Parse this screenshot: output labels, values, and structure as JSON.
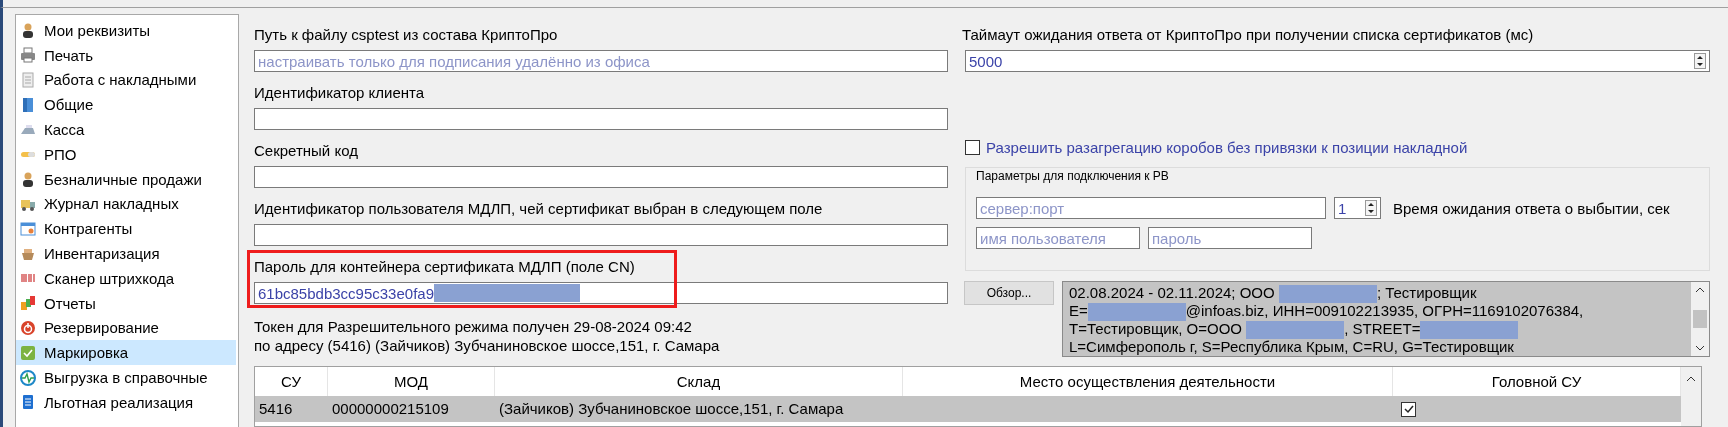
{
  "sidebar": {
    "items": [
      {
        "label": "Мои реквизиты",
        "selected": false
      },
      {
        "label": "Печать",
        "selected": false
      },
      {
        "label": "Работа с накладными",
        "selected": false
      },
      {
        "label": "Общие",
        "selected": false
      },
      {
        "label": "Касса",
        "selected": false
      },
      {
        "label": "РПО",
        "selected": false
      },
      {
        "label": "Безналичные продажи",
        "selected": false
      },
      {
        "label": "Журнал накладных",
        "selected": false
      },
      {
        "label": "Контрагенты",
        "selected": false
      },
      {
        "label": "Инвентаризация",
        "selected": false
      },
      {
        "label": "Сканер штрихкода",
        "selected": false
      },
      {
        "label": "Отчеты",
        "selected": false
      },
      {
        "label": "Резервирование",
        "selected": false
      },
      {
        "label": "Маркировка",
        "selected": true
      },
      {
        "label": "Выгрузка в справочные",
        "selected": false
      },
      {
        "label": "Льготная реализация",
        "selected": false
      }
    ]
  },
  "left_fields": [
    {
      "label": "Путь к файлу csptest из состава КриптоПро",
      "placeholder": "настраивать только для подписания удалённо из офиса",
      "highlighted": false
    },
    {
      "label": "Идентификатор клиента",
      "highlighted": false
    },
    {
      "label": "Секретный код",
      "highlighted": false
    },
    {
      "label": "Идентификатор пользователя МДЛП, чей сертификат выбран в следующем поле",
      "highlighted": false
    },
    {
      "label": "Пароль для контейнера сертификата МДЛП (поле CN)",
      "value": "61bc85bdb3cc95c33e0fa9",
      "redacted": true,
      "highlighted": true
    }
  ],
  "token_note": [
    "Токен для Разрешительного режима получен 29-08-2024 09:42",
    "по адресу (5416) (Зайчиков) Зубчаниновское шоссе,151, г. Самара"
  ],
  "timeout": {
    "label": "Таймаут ожидания ответа от КриптоПро при получении списка сертификатов (мс)",
    "value": "5000"
  },
  "disaggregation": {
    "label": "Разрешить разагрегацию коробов без привязки к позиции накладной",
    "checked": false
  },
  "rv_group": {
    "title": "Параметры для подключения к РВ",
    "server_placeholder": "сервер:порт",
    "wait_value": "1",
    "wait_label": "Время ожидания ответа о выбытии, сек",
    "user_placeholder": "имя пользователя",
    "password_placeholder": "пароль"
  },
  "browse_button": "Обзор...",
  "certificate": {
    "lines": [
      [
        {
          "kind": "text",
          "text": "02.08.2024 - 02.11.2024; ООО "
        },
        {
          "kind": "redacted"
        },
        {
          "kind": "text",
          "text": "; Тестировщик"
        }
      ],
      [
        {
          "kind": "text",
          "text": "E="
        },
        {
          "kind": "redacted"
        },
        {
          "kind": "text",
          "text": "@infoas.biz, ИНН=009102213935, ОГРН=1169102076384,"
        }
      ],
      [
        {
          "kind": "text",
          "text": "T=Тестировщик, O=ООО "
        },
        {
          "kind": "redacted"
        },
        {
          "kind": "text",
          "text": ", STREET="
        },
        {
          "kind": "redacted"
        }
      ],
      [
        {
          "kind": "text",
          "text": "L=Симферополь г, S=Республика Крым, C=RU, G=Тестировщик"
        }
      ]
    ]
  },
  "table": {
    "columns": [
      "СУ",
      "МОД",
      "Склад",
      "Место осуществления деятельности",
      "Головной СУ"
    ],
    "rows": [
      {
        "su": "5416",
        "mod": "00000000215109",
        "warehouse": "(Зайчиков) Зубчаниновское шоссе,151, г. Самара",
        "head": true,
        "selected": true
      }
    ]
  }
}
